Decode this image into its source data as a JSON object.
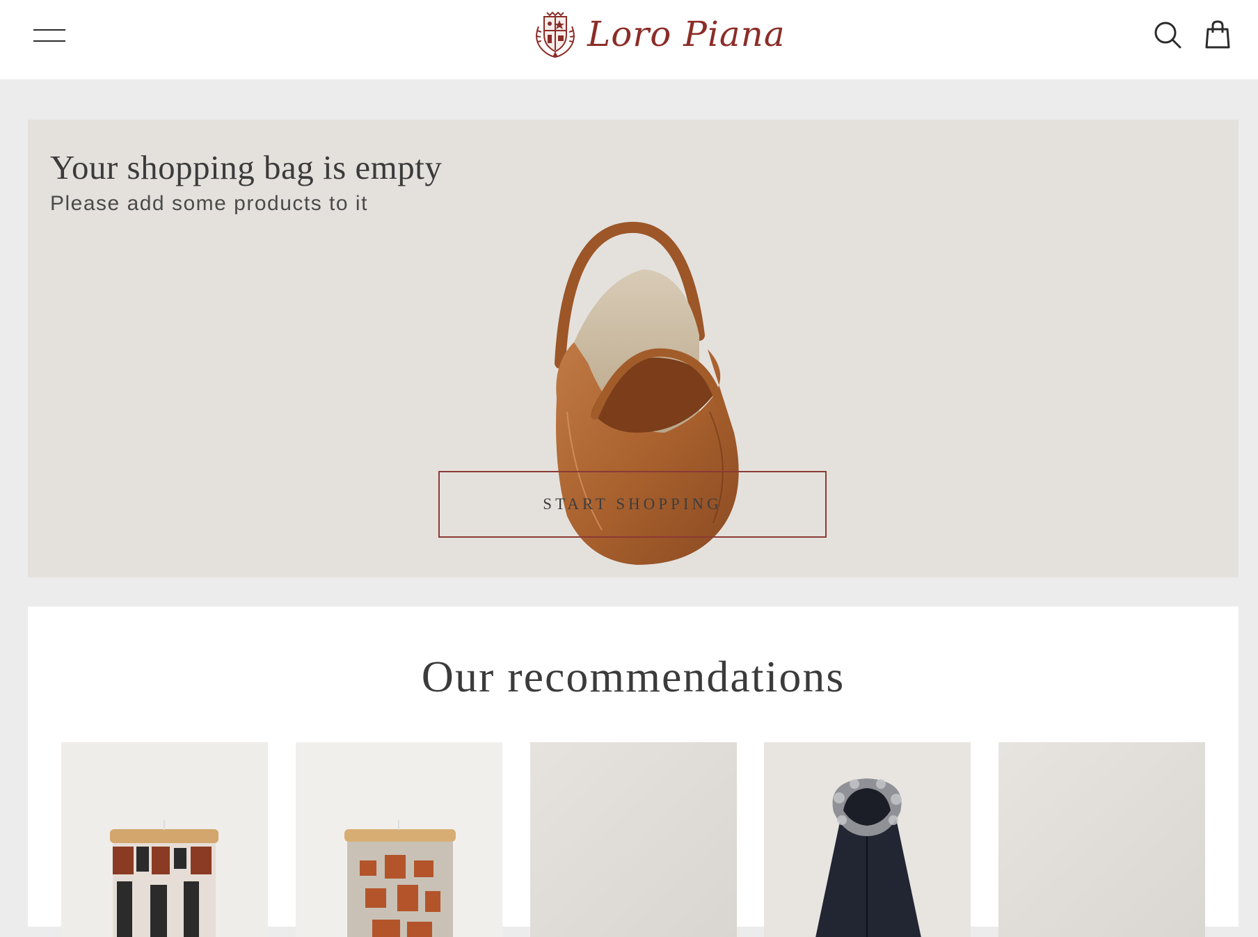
{
  "header": {
    "menu_icon": "hamburger-menu-icon",
    "brand": "Loro Piana",
    "search_icon": "search-icon",
    "bag_icon": "shopping-bag-icon"
  },
  "empty_bag": {
    "title": "Your shopping bag is empty",
    "subtitle": "Please add some products to it",
    "button_label": "START SHOPPING"
  },
  "recommendations": {
    "title": "Our recommendations",
    "products": [
      {
        "kind": "candle-striped"
      },
      {
        "kind": "candle-orange-pattern"
      },
      {
        "kind": "blank-gray"
      },
      {
        "kind": "fur-hood-parka"
      },
      {
        "kind": "blank-gray"
      }
    ]
  },
  "colors": {
    "brand": "#8b2d28",
    "panel_bg": "#e4e1dd",
    "page_bg": "#ececec"
  }
}
